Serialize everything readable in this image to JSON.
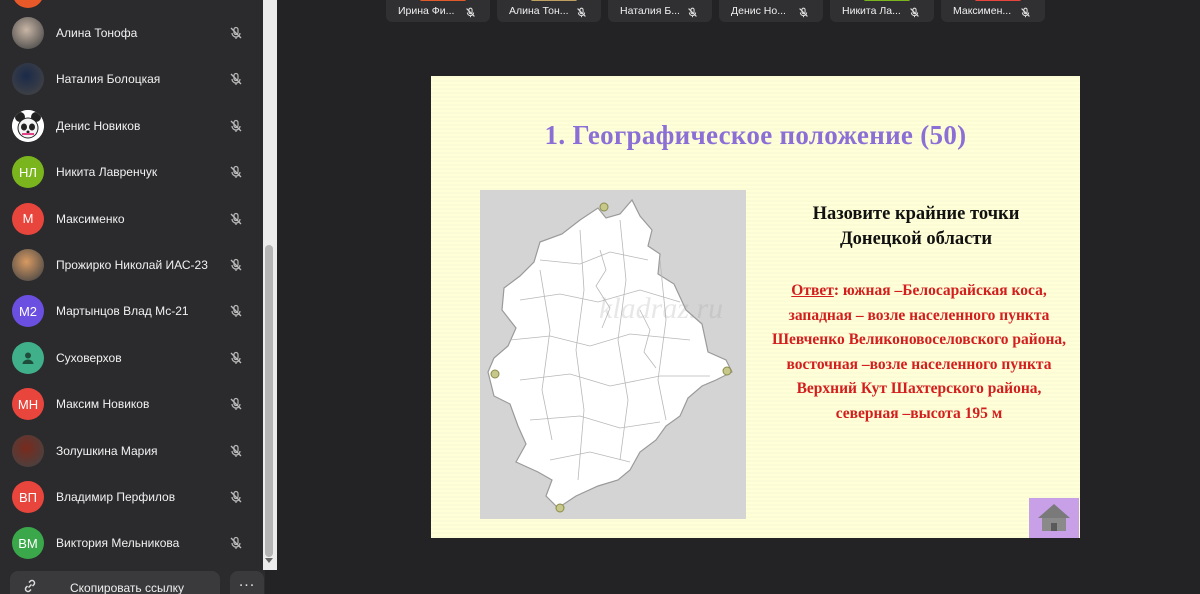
{
  "sidebar": {
    "participants": [
      {
        "name": "Алина Тонофа",
        "initials": "",
        "avatar_color": "#c9b6a6",
        "avatar_type": "photo"
      },
      {
        "name": "Наталия Болоцкая",
        "initials": "",
        "avatar_color": "#1b2a4a",
        "avatar_type": "photo"
      },
      {
        "name": "Денис Новиков",
        "initials": "",
        "avatar_color": "#ffffff",
        "avatar_type": "panda"
      },
      {
        "name": "Никита Лавренчук",
        "initials": "НЛ",
        "avatar_color": "#7ab51d",
        "avatar_type": "initials"
      },
      {
        "name": "Максименко",
        "initials": "М",
        "avatar_color": "#e8453c",
        "avatar_type": "initials"
      },
      {
        "name": "Прожирко Николай ИАС-23",
        "initials": "",
        "avatar_color": "#d89a62",
        "avatar_type": "photo"
      },
      {
        "name": "Мартынцов Влад Мс-21",
        "initials": "М2",
        "avatar_color": "#6b4fe0",
        "avatar_type": "initials"
      },
      {
        "name": "Суховерхов",
        "initials": "",
        "avatar_color": "#3fb08a",
        "avatar_type": "person"
      },
      {
        "name": "Максим Новиков",
        "initials": "МН",
        "avatar_color": "#e8453c",
        "avatar_type": "initials"
      },
      {
        "name": "Золушкина Мария",
        "initials": "",
        "avatar_color": "#7a2a1c",
        "avatar_type": "photo"
      },
      {
        "name": "Владимир Перфилов",
        "initials": "ВП",
        "avatar_color": "#e8453c",
        "avatar_type": "initials"
      },
      {
        "name": "Виктория Мельникова",
        "initials": "ВМ",
        "avatar_color": "#3aa84a",
        "avatar_type": "initials"
      }
    ],
    "copy_link_label": "Скопировать ссылку",
    "more_label": "..."
  },
  "top_tiles": [
    {
      "name": "Ирина Фи...",
      "bar_color": "#e05a2a"
    },
    {
      "name": "Алина Тон...",
      "bar_color": "#c0a060"
    },
    {
      "name": "Наталия Б...",
      "bar_color": ""
    },
    {
      "name": "Денис Но...",
      "bar_color": ""
    },
    {
      "name": "Никита Ла...",
      "bar_color": "#7ab51d"
    },
    {
      "name": "Максимен...",
      "bar_color": "#e8453c"
    }
  ],
  "slide": {
    "title": "1. Географическое положение  (50)",
    "question_line1": "Назовите крайние точки",
    "question_line2": "Донецкой области",
    "answer_label": "Ответ",
    "answer_text": ": южная  –Белосарайская коса, западная  –  возле населенного пункта Шевченко Великоновоселовского района, восточная –возле населенного пункта Верхний Кут Шахтерского района, северная –высота 195 м",
    "watermark": "kladraz.ru",
    "title_color": "#8b6fd6",
    "answer_color": "#d31e1e"
  }
}
